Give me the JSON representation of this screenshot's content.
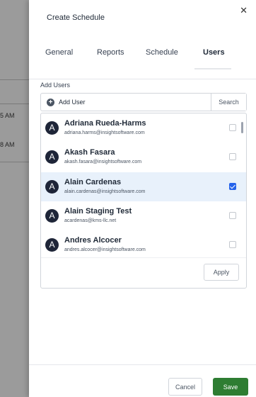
{
  "background": {
    "times": [
      "5 AM",
      "8 AM"
    ]
  },
  "drawer": {
    "title": "Create Schedule",
    "close_icon": "close-icon",
    "tabs": [
      {
        "label": "General",
        "active": false
      },
      {
        "label": "Reports",
        "active": false
      },
      {
        "label": "Schedule",
        "active": false
      },
      {
        "label": "Users",
        "active": true
      }
    ]
  },
  "add_users": {
    "label": "Add Users",
    "input_placeholder": "Add User",
    "search_label": "Search",
    "apply_label": "Apply",
    "users": [
      {
        "initial": "A",
        "name": "Adriana Rueda-Harms",
        "email": "adriana.harms@insightsoftware.com",
        "checked": false
      },
      {
        "initial": "A",
        "name": "Akash Fasara",
        "email": "akash.fasara@insightsoftware.com",
        "checked": false
      },
      {
        "initial": "A",
        "name": "Alain Cardenas",
        "email": "alain.cardenas@insightsoftware.com",
        "checked": true
      },
      {
        "initial": "A",
        "name": "Alain Staging Test",
        "email": "acardenas@kms-llc.net",
        "checked": false
      },
      {
        "initial": "A",
        "name": "Andres Alcocer",
        "email": "andres.alcocer@insightsoftware.com",
        "checked": false
      }
    ]
  },
  "footer": {
    "cancel_label": "Cancel",
    "save_label": "Save"
  },
  "colors": {
    "save": "#2e7d32",
    "checkbox_checked": "#2563eb",
    "selected_row": "#e8f1fb",
    "avatar": "#1e2538"
  }
}
